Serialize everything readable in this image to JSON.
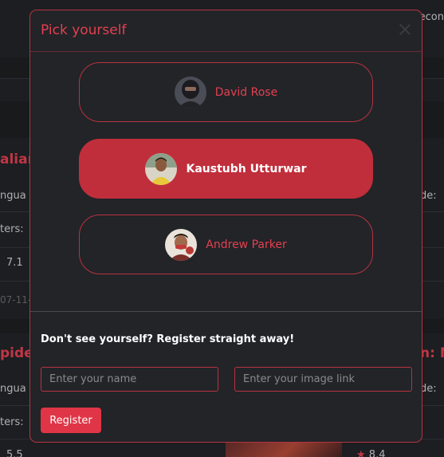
{
  "background": {
    "top_right_fragment": "econ",
    "card1": {
      "title_left": "alian",
      "lang_left": "ngua",
      "voters_left": "ters:",
      "rating_left": "7.1",
      "date_left": "07-11-",
      "lang_right": "de:"
    },
    "card2": {
      "title_left": "pide",
      "lang_left": "ngua",
      "voters_left": "ters:",
      "rating_left": "5.5",
      "title_right": "n: N",
      "lang_right": "de:",
      "rating_right": "8.4"
    }
  },
  "modal": {
    "title": "Pick yourself",
    "users": [
      {
        "name": "David Rose",
        "selected": false,
        "avatar": "hooded-person-avatar"
      },
      {
        "name": "Kaustubh Utturwar",
        "selected": true,
        "avatar": "man-yellow-shirt-avatar"
      },
      {
        "name": "Andrew Parker",
        "selected": false,
        "avatar": "man-eating-avatar"
      }
    ],
    "register_prompt": "Don't see yourself? Register straight away!",
    "name_placeholder": "Enter your name",
    "image_placeholder": "Enter your image link",
    "register_label": "Register"
  },
  "colors": {
    "accent": "#e34050",
    "selected": "#c12e3b",
    "background": "#222428"
  }
}
